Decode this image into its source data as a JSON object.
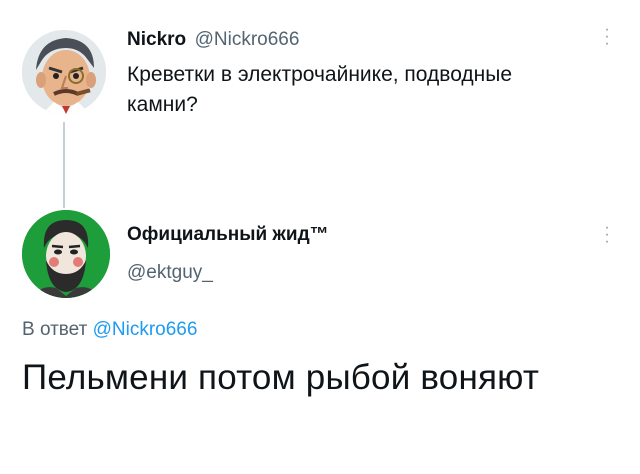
{
  "first_tweet": {
    "name": "Nickro",
    "handle": "@Nickro666",
    "text_line1": "Креветки в электрочайнике, подводные",
    "text_line2": "камни?"
  },
  "second_tweet": {
    "name": "Официальный жид™",
    "handle": "@ektguy_"
  },
  "reply": {
    "prefix": "В ответ",
    "mention": "@Nickro666",
    "text": "Пельмени потом рыбой воняют"
  },
  "icons": {
    "avatar1": "cartoon-man-avatar",
    "avatar2": "bearded-man-avatar",
    "more": "more-options-icon"
  },
  "colors": {
    "link": "#1d9bf0",
    "secondary": "#536471",
    "avatar2_bg": "#1e9e3a"
  }
}
